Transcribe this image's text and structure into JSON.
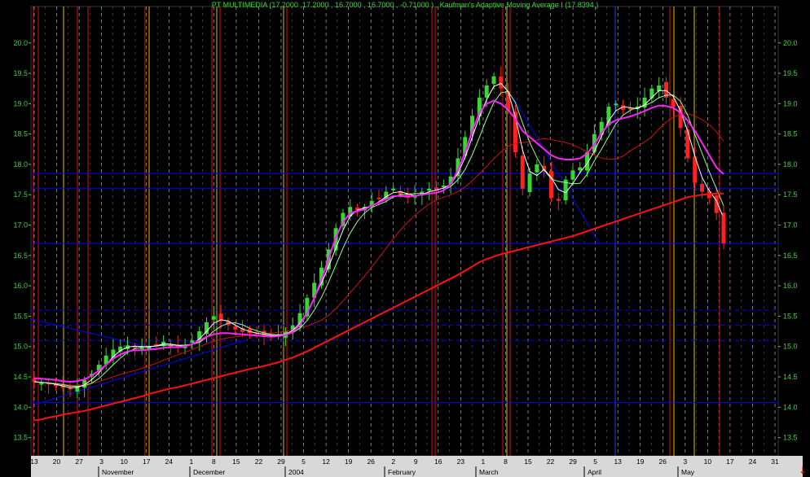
{
  "chart_data": {
    "type": "candlestick",
    "title": "PT MULTIMEDIA (17.2000 ,17.2000 , 16.7000 , 16.7000 , -0.71000 ) , Kaufman's Adaptive Moving Average I (17.8394 )",
    "ylim": [
      13.2,
      20.6
    ],
    "y_ticks": [
      13.5,
      14.0,
      14.5,
      15.0,
      15.5,
      16.0,
      16.5,
      17.0,
      17.5,
      18.0,
      18.5,
      19.0,
      19.5,
      20.0
    ],
    "y_tick_labels": [
      "13.5",
      "14.0",
      "14.5",
      "15.0",
      "15.5",
      "16.0",
      "16.5",
      "17.0",
      "17.5",
      "18.0",
      "18.5",
      "19.0",
      "19.5",
      "20.0"
    ],
    "x_day_labels": [
      "13",
      "20",
      "27",
      "3",
      "10",
      "17",
      "24",
      "1",
      "8",
      "15",
      "22",
      "29",
      "5",
      "12",
      "19",
      "26",
      "2",
      "9",
      "16",
      "23",
      "1",
      "8",
      "15",
      "22",
      "29",
      "5",
      "13",
      "19",
      "26",
      "3",
      "10",
      "17",
      "24",
      "31"
    ],
    "x_month_labels": [
      "November",
      "December",
      "2004",
      "February",
      "March",
      "April",
      "May"
    ],
    "horizontal_levels": [
      17.85,
      17.6,
      16.7,
      15.6,
      15.35,
      15.1,
      14.08
    ],
    "last_close": 16.7,
    "close": [
      14.42,
      14.4,
      14.38,
      14.35,
      14.32,
      14.3,
      14.36,
      14.45,
      14.55,
      14.7,
      14.85,
      14.95,
      15.0,
      15.02,
      15.0,
      14.98,
      15.01,
      15.04,
      15.08,
      15.0,
      14.98,
      15.02,
      15.1,
      15.25,
      15.4,
      15.5,
      15.42,
      15.35,
      15.28,
      15.24,
      15.22,
      15.2,
      15.18,
      15.16,
      15.2,
      15.25,
      15.35,
      15.55,
      15.8,
      16.05,
      16.3,
      16.6,
      16.95,
      17.2,
      17.3,
      17.25,
      17.3,
      17.4,
      17.45,
      17.55,
      17.6,
      17.5,
      17.45,
      17.5,
      17.55,
      17.6,
      17.58,
      17.65,
      17.8,
      18.1,
      18.45,
      18.8,
      19.1,
      19.3,
      19.45,
      19.25,
      18.9,
      18.2,
      17.6,
      17.85,
      18.0,
      17.9,
      17.45,
      17.4,
      17.75,
      17.9,
      17.95,
      18.2,
      18.5,
      18.7,
      18.95,
      19.0,
      18.9,
      18.9,
      18.95,
      19.1,
      19.25,
      19.3,
      19.1,
      18.95,
      18.6,
      18.1,
      17.7,
      17.55,
      17.45,
      17.2,
      16.7
    ],
    "kama": [
      14.48,
      14.47,
      14.46,
      14.45,
      14.43,
      14.42,
      14.43,
      14.46,
      14.52,
      14.6,
      14.7,
      14.8,
      14.87,
      14.92,
      14.94,
      14.94,
      14.95,
      14.96,
      14.98,
      14.99,
      14.99,
      15.0,
      15.04,
      15.1,
      15.16,
      15.2,
      15.22,
      15.22,
      15.21,
      15.2,
      15.19,
      15.18,
      15.17,
      15.16,
      15.17,
      15.19,
      15.24,
      15.36,
      15.55,
      15.8,
      16.1,
      16.45,
      16.8,
      17.05,
      17.2,
      17.23,
      17.26,
      17.32,
      17.37,
      17.43,
      17.48,
      17.48,
      17.47,
      17.48,
      17.5,
      17.52,
      17.53,
      17.57,
      17.68,
      17.9,
      18.2,
      18.55,
      18.85,
      19.0,
      19.05,
      19.0,
      18.9,
      18.75,
      18.55,
      18.45,
      18.35,
      18.25,
      18.15,
      18.1,
      18.08,
      18.08,
      18.1,
      18.18,
      18.33,
      18.52,
      18.66,
      18.73,
      18.76,
      18.79,
      18.83,
      18.88,
      18.93,
      18.97,
      18.96,
      18.93,
      18.85,
      18.72,
      18.55,
      18.35,
      18.15,
      17.95,
      17.84
    ],
    "sma_long": [
      13.78,
      13.8,
      13.83,
      13.85,
      13.88,
      13.9,
      13.92,
      13.94,
      13.97,
      14.0,
      14.03,
      14.06,
      14.09,
      14.12,
      14.15,
      14.18,
      14.22,
      14.25,
      14.28,
      14.31,
      14.33,
      14.36,
      14.39,
      14.42,
      14.45,
      14.48,
      14.51,
      14.54,
      14.57,
      14.6,
      14.63,
      14.65,
      14.68,
      14.71,
      14.74,
      14.78,
      14.82,
      14.87,
      14.92,
      14.98,
      15.04,
      15.1,
      15.16,
      15.22,
      15.28,
      15.34,
      15.4,
      15.46,
      15.52,
      15.58,
      15.64,
      15.7,
      15.76,
      15.82,
      15.88,
      15.94,
      16.0,
      16.06,
      16.12,
      16.18,
      16.25,
      16.32,
      16.39,
      16.44,
      16.48,
      16.52,
      16.55,
      16.58,
      16.61,
      16.64,
      16.67,
      16.7,
      16.73,
      16.76,
      16.79,
      16.82,
      16.86,
      16.9,
      16.94,
      16.98,
      17.02,
      17.06,
      17.1,
      17.14,
      17.18,
      17.22,
      17.26,
      17.3,
      17.34,
      17.38,
      17.42,
      17.46,
      17.48,
      17.5,
      17.51,
      17.52,
      17.52
    ]
  },
  "ui": {
    "scroll_arrow": "↓"
  },
  "colors": {
    "background": "#000000",
    "grid_vertical_dashed": "#cccccc",
    "grid_horizontal": "#0000ff",
    "axis_label": "#39d634",
    "candle_up": "#39d634",
    "candle_down": "#ff2020",
    "kama": "#ff20ff",
    "sma_long": "#ff1010",
    "ma_white": "#ffffff",
    "ma_lightgreen": "#90ff90",
    "ma_darkred": "#cc1010",
    "event_red": "#e01010",
    "event_yellow": "#e0c000",
    "event_blue": "#2040ff"
  }
}
